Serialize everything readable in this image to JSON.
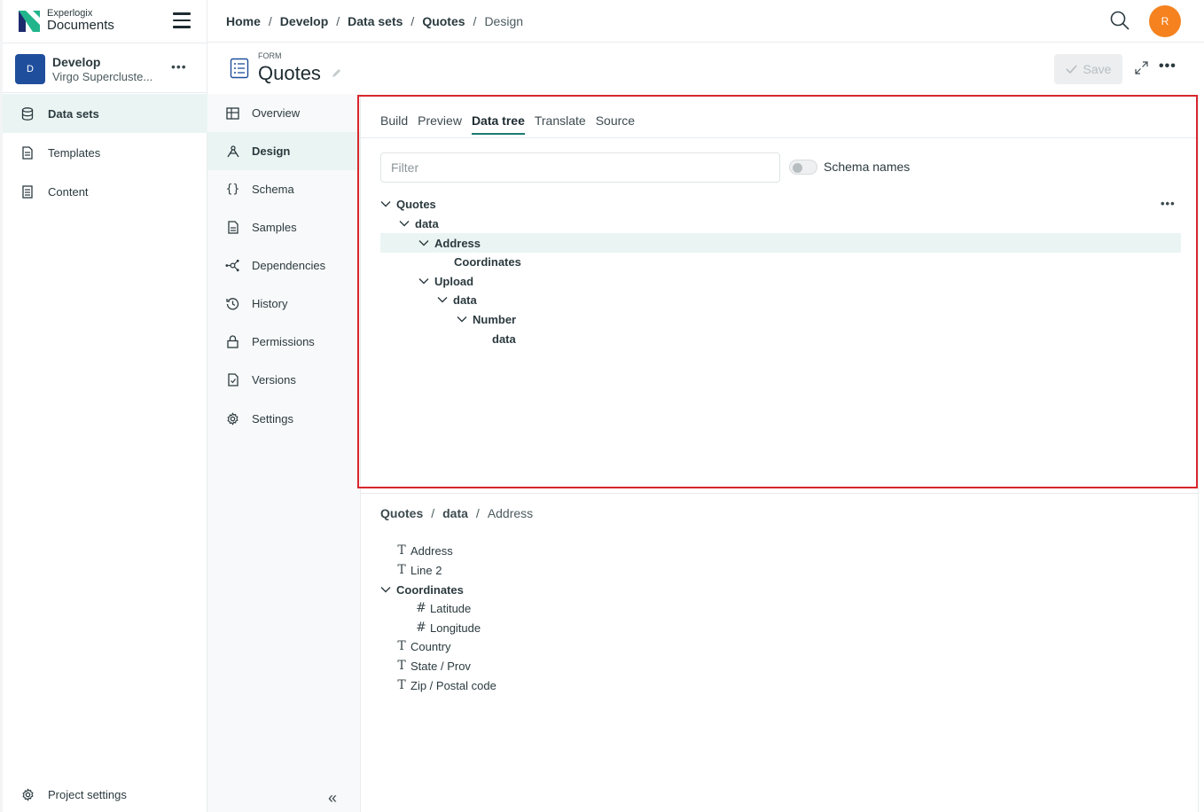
{
  "brand": {
    "small": "Experlogix",
    "big": "Documents"
  },
  "project": {
    "avatar_letter": "D",
    "name": "Develop",
    "subtitle": "Virgo Supercluste...",
    "more": "•••"
  },
  "nav": {
    "items": [
      {
        "label": "Data sets",
        "icon": "database-icon",
        "active": true
      },
      {
        "label": "Templates",
        "icon": "document-icon",
        "active": false
      },
      {
        "label": "Content",
        "icon": "content-icon",
        "active": false
      }
    ],
    "project_settings": "Project settings"
  },
  "topbar": {
    "breadcrumb": [
      "Home",
      "Develop",
      "Data sets",
      "Quotes"
    ],
    "current": "Design",
    "separator": "/",
    "user_initial": "R"
  },
  "header": {
    "kind": "FORM",
    "title": "Quotes",
    "save_label": "Save",
    "more": "•••"
  },
  "subnav": {
    "items": [
      {
        "label": "Overview",
        "icon": "grid-icon"
      },
      {
        "label": "Design",
        "icon": "design-icon",
        "active": true
      },
      {
        "label": "Schema",
        "icon": "braces-icon"
      },
      {
        "label": "Samples",
        "icon": "file-icon"
      },
      {
        "label": "Dependencies",
        "icon": "network-icon"
      },
      {
        "label": "History",
        "icon": "history-icon"
      },
      {
        "label": "Permissions",
        "icon": "lock-icon"
      },
      {
        "label": "Versions",
        "icon": "versions-icon"
      },
      {
        "label": "Settings",
        "icon": "gear-icon"
      }
    ],
    "collapse": "«"
  },
  "tabs": [
    "Build",
    "Preview",
    "Data tree",
    "Translate",
    "Source"
  ],
  "active_tab": "Data tree",
  "filter": {
    "placeholder": "Filter",
    "value": ""
  },
  "schema_toggle": {
    "label": "Schema names",
    "on": false
  },
  "tree": {
    "more": "•••",
    "nodes": [
      {
        "label": "Quotes",
        "level": 0,
        "expanded": true
      },
      {
        "label": "data",
        "level": 1,
        "expanded": true
      },
      {
        "label": "Address",
        "level": 2,
        "expanded": true,
        "selected": true
      },
      {
        "label": "Coordinates",
        "level": 3,
        "leaf": true
      },
      {
        "label": "Upload",
        "level": 2,
        "expanded": true
      },
      {
        "label": "data",
        "level": 3,
        "expanded": true
      },
      {
        "label": "Number",
        "level": 4,
        "expanded": true
      },
      {
        "label": "data",
        "level": 5,
        "leaf": true
      }
    ]
  },
  "detail": {
    "breadcrumb": [
      "Quotes",
      "data"
    ],
    "current": "Address",
    "separator": "/",
    "fields": [
      {
        "label": "Address",
        "type": "text",
        "level": 0
      },
      {
        "label": "Line 2",
        "type": "text",
        "level": 0
      },
      {
        "label": "Coordinates",
        "type": "group",
        "level": 0
      },
      {
        "label": "Latitude",
        "type": "number",
        "level": 1
      },
      {
        "label": "Longitude",
        "type": "number",
        "level": 1
      },
      {
        "label": "Country",
        "type": "text",
        "level": 0
      },
      {
        "label": "State / Prov",
        "type": "text",
        "level": 0
      },
      {
        "label": "Zip / Postal code",
        "type": "text",
        "level": 0
      }
    ]
  },
  "colors": {
    "accent": "#1d7a72",
    "selected_bg": "#eaf5f3",
    "avatar": "#f5821f",
    "project_avatar": "#1f4e9c",
    "highlight": "#d9262c"
  }
}
